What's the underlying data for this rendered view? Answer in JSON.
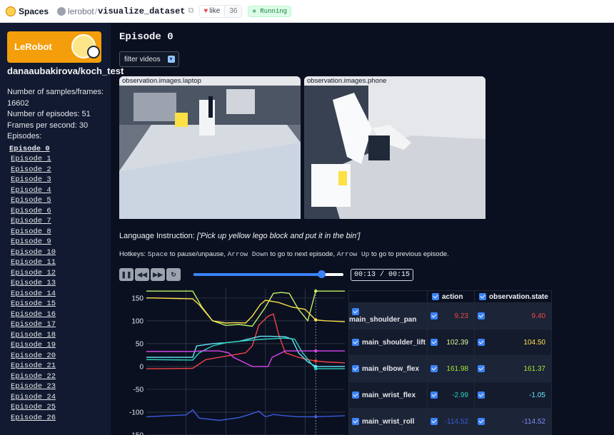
{
  "topbar": {
    "spaces_label": "Spaces",
    "owner": "lerobot",
    "repo": "visualize_dataset",
    "like_label": "like",
    "like_count": "36",
    "status": "Running"
  },
  "sidebar": {
    "logo_text": "LeRobot",
    "dataset_name": "danaaubakirova/koch_test",
    "stats": {
      "samples": "Number of samples/frames: 16602",
      "episodes": "Number of episodes: 51",
      "fps": "Frames per second: 30",
      "episodes_label": "Episodes:"
    },
    "episodes": [
      "Episode 0",
      "Episode 1",
      "Episode 2",
      "Episode 3",
      "Episode 4",
      "Episode 5",
      "Episode 6",
      "Episode 7",
      "Episode 8",
      "Episode 9",
      "Episode 10",
      "Episode 11",
      "Episode 12",
      "Episode 13",
      "Episode 14",
      "Episode 15",
      "Episode 16",
      "Episode 17",
      "Episode 18",
      "Episode 19",
      "Episode 20",
      "Episode 21",
      "Episode 22",
      "Episode 23",
      "Episode 24",
      "Episode 25",
      "Episode 26"
    ],
    "active_episode": 0
  },
  "main": {
    "episode_title": "Episode 0",
    "filter_label": "filter videos",
    "videos": [
      {
        "label": "observation.images.laptop"
      },
      {
        "label": "observation.images.phone"
      }
    ],
    "language_prefix": "Language Instruction: ",
    "language_text": "['Pick up yellow lego block and put it in the bin']",
    "hotkeys": {
      "p1": "Hotkeys: ",
      "k1": "Space",
      "p2": " to pause/unpause, ",
      "k2": "Arrow Down",
      "p3": " to go to next episode, ",
      "k3": "Arrow Up",
      "p4": " to go to previous episode."
    },
    "player": {
      "time": "00:13 / 00:15",
      "progress": 0.85
    }
  },
  "chart_data": {
    "type": "line",
    "y_ticks": [
      150,
      100,
      50,
      0,
      -50,
      -100,
      -150
    ],
    "ylim": [
      -150,
      170
    ],
    "xlim": [
      0,
      15
    ],
    "cursor_x": 12.8,
    "series": [
      {
        "color": "#bef264",
        "x": [
          0,
          0.5,
          3.5,
          4.2,
          5.0,
          6.0,
          7.0,
          8.0,
          9.0,
          9.6,
          10.2,
          10.8,
          11.5,
          12.2,
          12.8,
          13.5,
          15
        ],
        "y": [
          165,
          165,
          165,
          130,
          100,
          90,
          92,
          88,
          130,
          160,
          162,
          160,
          125,
          100,
          165,
          165,
          165
        ]
      },
      {
        "color": "#fde047",
        "x": [
          0,
          0.5,
          3.5,
          4.0,
          5.0,
          6.0,
          6.8,
          7.5,
          8.0,
          8.6,
          9.0,
          10.0,
          11.0,
          12.0,
          12.8,
          13.5,
          15
        ],
        "y": [
          150,
          150,
          148,
          135,
          100,
          95,
          96,
          95,
          110,
          135,
          145,
          140,
          130,
          125,
          102,
          100,
          98
        ]
      },
      {
        "color": "#ef4444",
        "x": [
          0,
          0.5,
          3.5,
          4.5,
          5.5,
          6.5,
          7.5,
          8.0,
          8.5,
          9.2,
          9.6,
          10.0,
          10.5,
          11.5,
          12.2,
          12.8,
          13.5,
          15
        ],
        "y": [
          -5,
          -5,
          -4,
          15,
          20,
          25,
          30,
          45,
          90,
          110,
          115,
          70,
          30,
          20,
          15,
          12,
          10,
          8
        ]
      },
      {
        "color": "#67e8f9",
        "x": [
          0,
          0.5,
          3.5,
          3.8,
          5.0,
          6.0,
          7.0,
          8.0,
          8.6,
          9.4,
          10.5,
          11.0,
          11.5,
          12.2,
          12.8,
          13.5,
          15
        ],
        "y": [
          20,
          20,
          20,
          45,
          50,
          52,
          55,
          62,
          66,
          66,
          65,
          60,
          30,
          10,
          0,
          0,
          0
        ]
      },
      {
        "color": "#2dd4bf",
        "x": [
          0,
          0.5,
          3.5,
          4.0,
          5.0,
          6.0,
          7.0,
          8.0,
          9.0,
          10.5,
          11.2,
          11.8,
          12.5,
          12.8,
          13.5,
          15
        ],
        "y": [
          15,
          15,
          14,
          30,
          45,
          52,
          55,
          58,
          60,
          62,
          60,
          30,
          5,
          -5,
          -5,
          -5
        ]
      },
      {
        "color": "#d946ef",
        "x": [
          0,
          0.5,
          3.5,
          4.2,
          5.5,
          6.2,
          6.6,
          8.0,
          9.2,
          9.5,
          10.5,
          12.0,
          12.8,
          15
        ],
        "y": [
          33,
          33,
          33,
          34,
          34,
          30,
          20,
          0,
          0,
          20,
          34,
          34,
          34,
          34
        ]
      },
      {
        "color": "#3b5bdb",
        "x": [
          0,
          1.5,
          3.0,
          3.5,
          4.0,
          5.5,
          7.0,
          7.8,
          8.5,
          9.0,
          9.6,
          10.5,
          11.5,
          12.8,
          15
        ],
        "y": [
          -110,
          -108,
          -106,
          -95,
          -113,
          -118,
          -112,
          -105,
          -98,
          -110,
          -105,
          -108,
          -110,
          -110,
          -108
        ]
      }
    ]
  },
  "table": {
    "headers": {
      "action": "action",
      "state": "observation.state"
    },
    "rows": [
      {
        "name": "main_shoulder_pan",
        "action": "9.23",
        "state": "9.40",
        "action_color": "#ef4444",
        "state_color": "#ef4444"
      },
      {
        "name": "main_shoulder_lift",
        "action": "102.39",
        "state": "104.50",
        "action_color": "#d9f99d",
        "state_color": "#fde047"
      },
      {
        "name": "main_elbow_flex",
        "action": "161.98",
        "state": "161.37",
        "action_color": "#a3e635",
        "state_color": "#a3e635"
      },
      {
        "name": "main_wrist_flex",
        "action": "-2.99",
        "state": "-1.05",
        "action_color": "#2dd4bf",
        "state_color": "#67e8f9"
      },
      {
        "name": "main_wrist_roll",
        "action": "-114.52",
        "state": "-114.52",
        "action_color": "#3b5bdb",
        "state_color": "#818cf8"
      }
    ]
  }
}
